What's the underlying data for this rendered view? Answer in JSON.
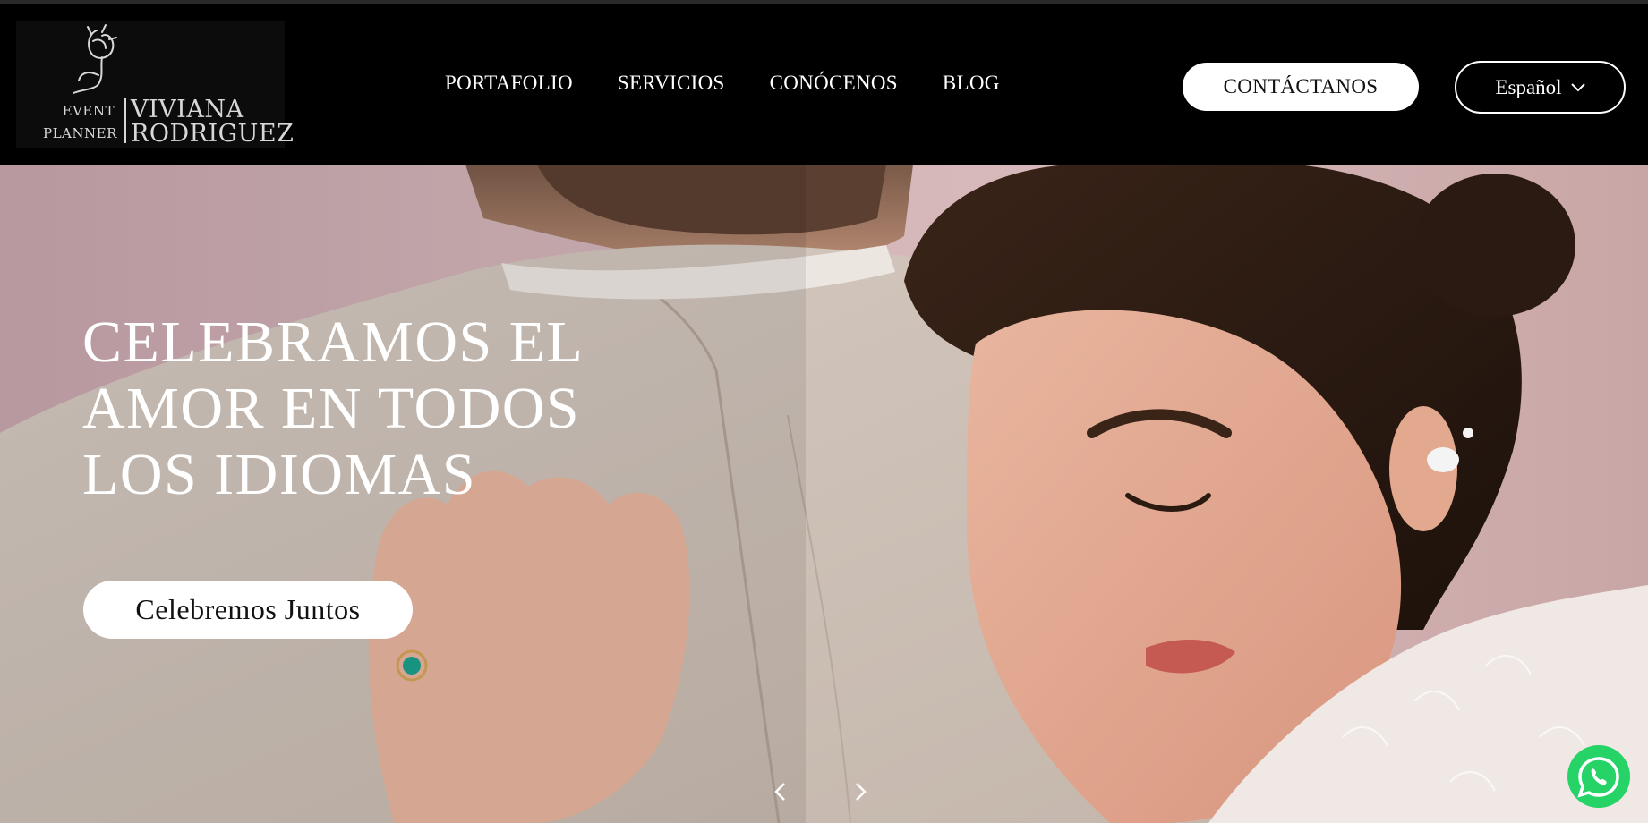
{
  "brand": {
    "event_line1": "EVENT",
    "event_line2": "PLANNER",
    "name_line1": "VIVIANA",
    "name_line2": "RODRIGUEZ",
    "logo_icon": "rose-icon"
  },
  "nav": {
    "items": [
      {
        "label": "PORTAFOLIO"
      },
      {
        "label": "SERVICIOS"
      },
      {
        "label": "CONÓCENOS"
      },
      {
        "label": "BLOG"
      }
    ]
  },
  "header": {
    "contact_label": "CONTÁCTANOS",
    "language_label": "Español",
    "language_icon": "chevron-down-icon"
  },
  "hero": {
    "title_lines": [
      "CELEBRAMOS EL",
      "AMOR EN TODOS",
      "LOS IDIOMAS"
    ],
    "cta_label": "Celebremos Juntos",
    "prev_icon": "chevron-left-icon",
    "next_icon": "chevron-right-icon"
  },
  "chat": {
    "icon": "whatsapp-icon",
    "color": "#25D366"
  },
  "colors": {
    "header_bg": "#000000",
    "text_light": "#ffffff"
  }
}
